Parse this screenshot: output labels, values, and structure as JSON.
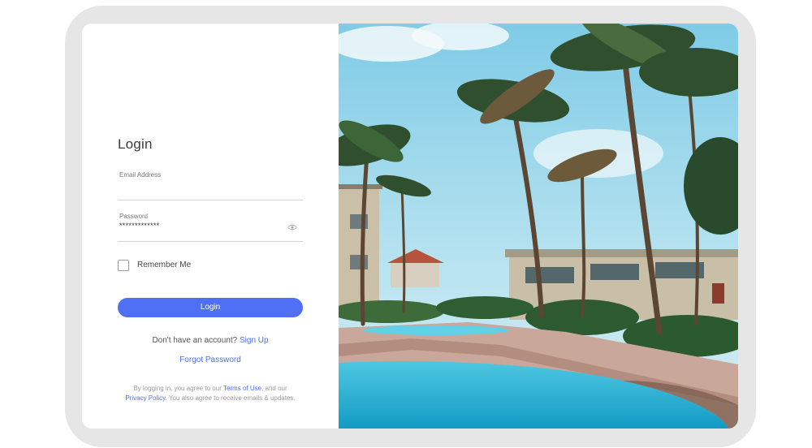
{
  "login_form": {
    "title": "Login",
    "email": {
      "label": "Email Address",
      "value": "",
      "placeholder": ""
    },
    "password": {
      "label": "Password",
      "value": "*************"
    },
    "remember_me": {
      "label": "Remember Me",
      "checked": false
    },
    "submit_label": "Login",
    "signup_prompt": "Don't have an account?",
    "signup_link": "Sign Up",
    "forgot_password": "Forgot Password",
    "terms": {
      "prefix": "By logging in, you agree to our",
      "terms_link": "Terms of Use",
      "middle": ", and our",
      "privacy_link": "Privacy Policy",
      "suffix": ". You also agree to receive emails & updates."
    }
  },
  "icons": {
    "password_toggle": "eye-icon"
  },
  "colors": {
    "accent": "#4f6ff5",
    "frame": "#e6e6e6",
    "pool_water": "#29b6d6",
    "sky": "#8fd6ee"
  }
}
